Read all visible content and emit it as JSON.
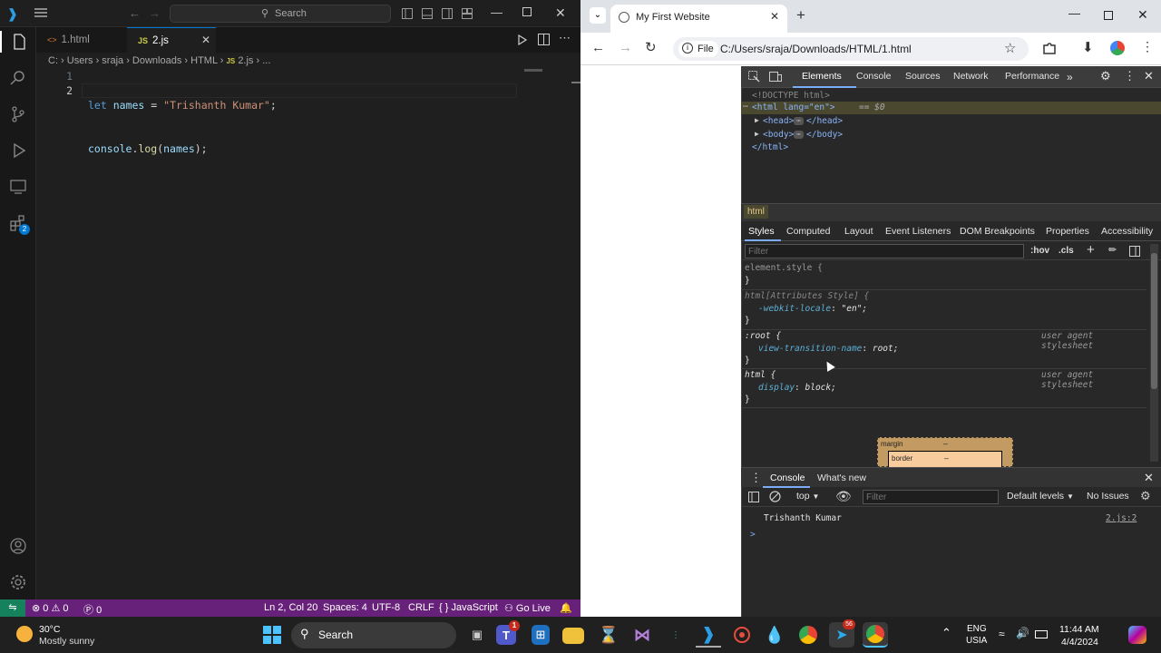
{
  "vscode": {
    "search_placeholder": "Search",
    "tabs": [
      {
        "label": "1.html",
        "icon": "<>"
      },
      {
        "label": "2.js",
        "icon": "JS"
      }
    ],
    "breadcrumb": [
      "C:",
      "Users",
      "sraja",
      "Downloads",
      "HTML",
      "2.js",
      "..."
    ],
    "breadcrumb_js_icon": "JS",
    "line_numbers": [
      "1",
      "2"
    ],
    "code": {
      "l1_kw": "let",
      "l1_var": "names",
      "l1_eq": "=",
      "l1_str": "\"Trishanth Kumar\"",
      "l1_end": ";",
      "l2_obj": "console",
      "l2_dot": ".",
      "l2_fn": "log",
      "l2_open": "(",
      "l2_arg": "names",
      "l2_close": ");"
    },
    "extensions_badge": "2",
    "status": {
      "errors": "0",
      "warnings": "0",
      "ports": "0",
      "position": "Ln 2, Col 20",
      "spaces": "Spaces: 4",
      "encoding": "UTF-8",
      "eol": "CRLF",
      "language": "{ } JavaScript",
      "golive": "Go Live"
    }
  },
  "chrome": {
    "tab_title": "My First Website",
    "url_chip": "File",
    "url": "C:/Users/sraja/Downloads/HTML/1.html"
  },
  "devtools": {
    "main_tabs": [
      "Elements",
      "Console",
      "Sources",
      "Network",
      "Performance"
    ],
    "dom": {
      "doctype": "<!DOCTYPE html>",
      "html_open": "<html lang=\"en\">",
      "html_suffix": "== $0",
      "head": "<head>",
      "head_close": "</head>",
      "body": "<body>",
      "body_close": "</body>",
      "html_close": "</html>"
    },
    "crumb": "html",
    "panel_tabs": [
      "Styles",
      "Computed",
      "Layout",
      "Event Listeners",
      "DOM Breakpoints",
      "Properties",
      "Accessibility"
    ],
    "filter_placeholder": "Filter",
    "hov": ":hov",
    "cls": ".cls",
    "rules": [
      {
        "selector": "element.style {",
        "props": [],
        "close": "}",
        "origin": ""
      },
      {
        "selector": "html[Attributes Style] {",
        "props": [
          {
            "name": "-webkit-locale",
            "value": "\"en\";"
          }
        ],
        "close": "}",
        "origin": ""
      },
      {
        "selector": ":root {",
        "props": [
          {
            "name": "view-transition-name",
            "value": "root;"
          }
        ],
        "close": "}",
        "origin": "user agent stylesheet"
      },
      {
        "selector": "html {",
        "props": [
          {
            "name": "display",
            "value": "block;"
          }
        ],
        "close": "}",
        "origin": "user agent stylesheet"
      }
    ],
    "boxmodel": {
      "margin": "margin",
      "margin_val": "–",
      "border": "border",
      "border_val": "–"
    },
    "drawer_tabs": [
      "Console",
      "What's new"
    ],
    "console_context": "top",
    "console_filter_placeholder": "Filter",
    "levels": "Default levels",
    "issues": "No Issues",
    "log_text": "Trishanth Kumar",
    "log_source": "2.js:2",
    "prompt": ">"
  },
  "taskbar": {
    "temp": "30°C",
    "weather": "Mostly sunny",
    "search": "Search",
    "lang1": "ENG",
    "lang2": "USIA",
    "time": "11:44 AM",
    "date": "4/4/2024",
    "teams_badge": "1",
    "chrome_badge": "56"
  },
  "colors": {
    "vscode_status": "#68217a",
    "accent": "#0078d4",
    "devtools_bg": "#282828"
  }
}
